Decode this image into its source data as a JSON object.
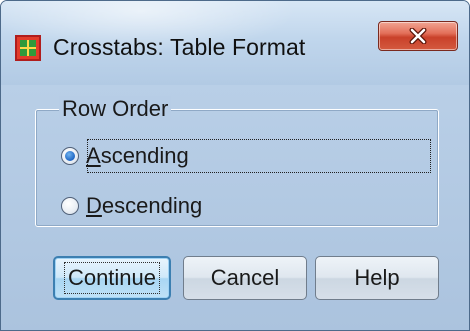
{
  "window": {
    "title": "Crosstabs: Table Format",
    "icon": "spss-crosstabs-icon",
    "close_icon": "close-x-icon"
  },
  "row_order": {
    "legend": "Row Order",
    "options": [
      {
        "label_underlined": "A",
        "label_rest": "scending",
        "checked": true
      },
      {
        "label_underlined": "D",
        "label_rest": "escending",
        "checked": false
      }
    ]
  },
  "buttons": {
    "continue": "Continue",
    "cancel": "Cancel",
    "help": "Help"
  },
  "colors": {
    "chrome": "#b7cde6",
    "close_button": "#c9412a",
    "default_button_border": "#3c7fb1"
  }
}
